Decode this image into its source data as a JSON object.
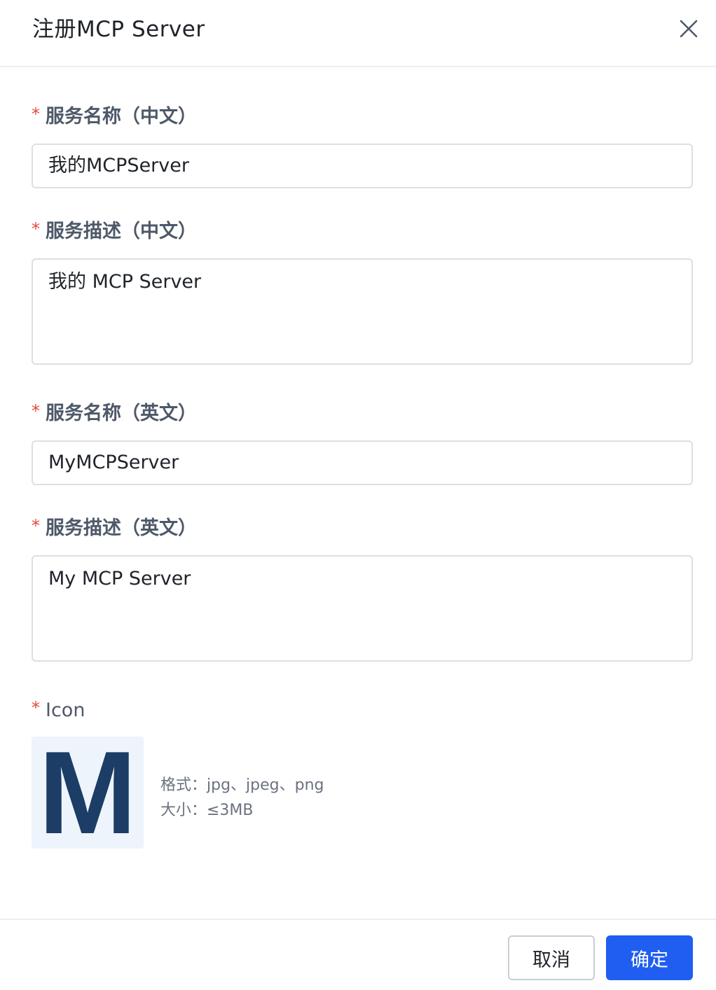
{
  "dialog": {
    "title": "注册MCP Server"
  },
  "form": {
    "name_zh": {
      "required_mark": "*",
      "label": "服务名称（中文）",
      "value": "我的MCPServer"
    },
    "desc_zh": {
      "required_mark": "*",
      "label": "服务描述（中文）",
      "value": "我的 MCP Server"
    },
    "name_en": {
      "required_mark": "*",
      "label": "服务名称（英文）",
      "value": "MyMCPServer"
    },
    "desc_en": {
      "required_mark": "*",
      "label": "服务描述（英文）",
      "value": "My MCP Server"
    },
    "icon": {
      "required_mark": "*",
      "label": "Icon",
      "preview_letter": "M",
      "format_hint": "格式：jpg、jpeg、png",
      "size_hint": "大小：≤3MB"
    }
  },
  "footer": {
    "cancel_label": "取消",
    "confirm_label": "确定"
  },
  "colors": {
    "primary": "#1f5ef0",
    "required": "#e5483c",
    "icon_letter": "#1b3d66"
  }
}
